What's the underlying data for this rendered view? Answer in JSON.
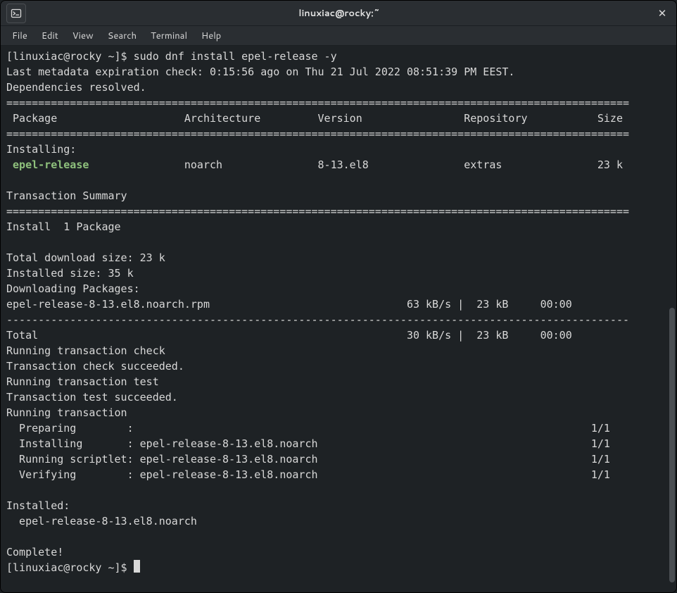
{
  "window": {
    "title": "linuxiac@rocky:~"
  },
  "menu": {
    "items": [
      "File",
      "Edit",
      "View",
      "Search",
      "Terminal",
      "Help"
    ]
  },
  "term": {
    "prompt": "[linuxiac@rocky ~]$ ",
    "cmd": "sudo dnf install epel-release -y",
    "meta1": "Last metadata expiration check: 0:15:56 ago on Thu 21 Jul 2022 08:51:39 PM EEST.",
    "meta2": "Dependencies resolved.",
    "hr": "==================================================================================================",
    "hdr": " Package                    Architecture         Version                Repository           Size",
    "sec_installing": "Installing:",
    "pkg_name": " epel-release",
    "pkg_rest": "               noarch               8-13.el8               extras               23 k",
    "ts_summary": "Transaction Summary",
    "install_count": "Install  1 Package",
    "dl_size": "Total download size: 23 k",
    "inst_size": "Installed size: 35 k",
    "dl_pkgs": "Downloading Packages:",
    "dl_line": "epel-release-8-13.el8.noarch.rpm                               63 kB/s |  23 kB     00:00    ",
    "dash": "--------------------------------------------------------------------------------------------------",
    "total": "Total                                                          30 kB/s |  23 kB     00:00     ",
    "r1": "Running transaction check",
    "r2": "Transaction check succeeded.",
    "r3": "Running transaction test",
    "r4": "Transaction test succeeded.",
    "r5": "Running transaction",
    "step1": "  Preparing        :                                                                        1/1 ",
    "step2": "  Installing       : epel-release-8-13.el8.noarch                                           1/1 ",
    "step3": "  Running scriptlet: epel-release-8-13.el8.noarch                                           1/1 ",
    "step4": "  Verifying        : epel-release-8-13.el8.noarch                                           1/1 ",
    "installed_hdr": "Installed:",
    "installed_pkg": "  epel-release-8-13.el8.noarch                                                                    ",
    "complete": "Complete!",
    "prompt2": "[linuxiac@rocky ~]$ "
  }
}
